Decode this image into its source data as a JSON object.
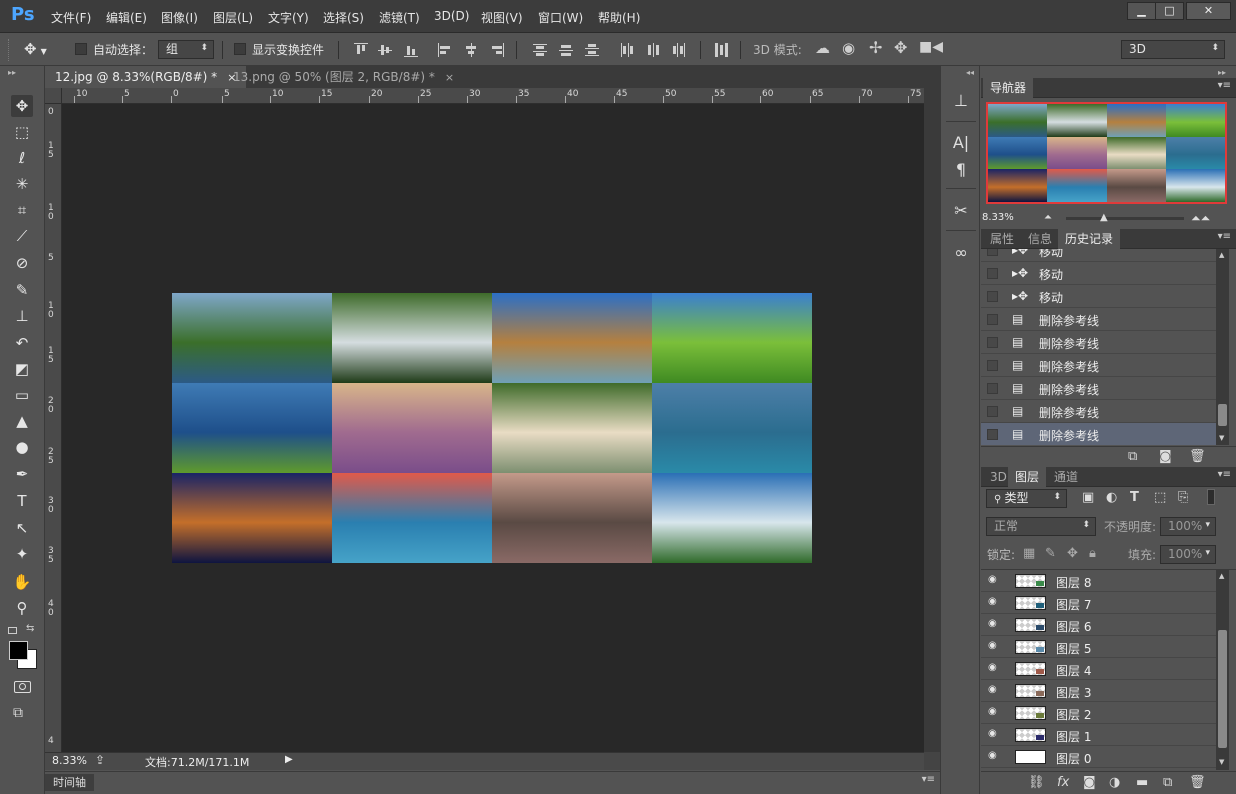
{
  "app": {
    "logo": "Ps"
  },
  "menu": [
    "文件(F)",
    "编辑(E)",
    "图像(I)",
    "图层(L)",
    "文字(Y)",
    "选择(S)",
    "滤镜(T)",
    "3D(D)",
    "视图(V)",
    "窗口(W)",
    "帮助(H)"
  ],
  "window_controls": {
    "minimize": "▁",
    "maximize": "□",
    "close": "✕"
  },
  "options": {
    "auto_select_label": "自动选择：",
    "auto_select_target": "组",
    "show_transform_label": "显示变换控件",
    "mode_3d_label": "3D 模式:",
    "workspace": "3D"
  },
  "tabs": [
    {
      "label": "12.jpg @ 8.33%(RGB/8#) *",
      "close": "×",
      "active": true
    },
    {
      "label": "13.png @ 50% (图层 2, RGB/8#) *",
      "close": "×",
      "active": false
    }
  ],
  "ruler_top": [
    "10",
    "5",
    "0",
    "5",
    "10",
    "15",
    "20",
    "25",
    "30",
    "35",
    "40",
    "45",
    "50",
    "55",
    "60",
    "65",
    "70",
    "75"
  ],
  "ruler_left": [
    "0",
    "1\n5",
    "1\n0",
    "5",
    "1\n0",
    "1\n5",
    "2\n0",
    "2\n5",
    "3\n0",
    "3\n5",
    "4\n0",
    "4"
  ],
  "tools": [
    {
      "icon": "move-icon",
      "glyph": "✥"
    },
    {
      "icon": "marquee-icon",
      "glyph": "⬚"
    },
    {
      "icon": "lasso-icon",
      "glyph": "ℓ"
    },
    {
      "icon": "magic-wand-icon",
      "glyph": "✳"
    },
    {
      "icon": "crop-icon",
      "glyph": "⌗"
    },
    {
      "icon": "eyedropper-icon",
      "glyph": "⟋"
    },
    {
      "icon": "healing-brush-icon",
      "glyph": "⊘"
    },
    {
      "icon": "brush-icon",
      "glyph": "✎"
    },
    {
      "icon": "clone-stamp-icon",
      "glyph": "⊥"
    },
    {
      "icon": "history-brush-icon",
      "glyph": "↶"
    },
    {
      "icon": "eraser-icon",
      "glyph": "◩"
    },
    {
      "icon": "gradient-icon",
      "glyph": "▭"
    },
    {
      "icon": "blur-icon",
      "glyph": "▲"
    },
    {
      "icon": "dodge-icon",
      "glyph": "●"
    },
    {
      "icon": "pen-icon",
      "glyph": "✒"
    },
    {
      "icon": "type-icon",
      "glyph": "T"
    },
    {
      "icon": "path-select-icon",
      "glyph": "↖"
    },
    {
      "icon": "shape-icon",
      "glyph": "✦"
    },
    {
      "icon": "hand-icon",
      "glyph": "✋"
    },
    {
      "icon": "zoom-icon",
      "glyph": "⚲"
    }
  ],
  "status": {
    "zoom": "8.33%",
    "doc": "文档:71.2M/171.1M"
  },
  "timeline_label": "时间轴",
  "navigator": {
    "tab": "导航器",
    "zoom": "8.33%"
  },
  "info_tabs": [
    "属性",
    "信息",
    "历史记录"
  ],
  "history": [
    {
      "label": "移动",
      "icon": "move-icon"
    },
    {
      "label": "移动",
      "icon": "move-icon"
    },
    {
      "label": "移动",
      "icon": "move-icon"
    },
    {
      "label": "删除参考线",
      "icon": "document-icon"
    },
    {
      "label": "删除参考线",
      "icon": "document-icon"
    },
    {
      "label": "删除参考线",
      "icon": "document-icon"
    },
    {
      "label": "删除参考线",
      "icon": "document-icon"
    },
    {
      "label": "删除参考线",
      "icon": "document-icon"
    },
    {
      "label": "删除参考线",
      "icon": "document-icon"
    }
  ],
  "layers_tabs": [
    "3D",
    "图层",
    "通道"
  ],
  "layers_panel": {
    "filter_kind": "类型",
    "blend_mode": "正常",
    "opacity_label": "不透明度:",
    "opacity": "100%",
    "lock_label": "锁定:",
    "fill_label": "填充:",
    "fill": "100%"
  },
  "layers": [
    "图层 8",
    "图层 7",
    "图层 6",
    "图层 5",
    "图层 4",
    "图层 3",
    "图层 2",
    "图层 1",
    "图层 0"
  ],
  "image_grid": {
    "cells": [
      {
        "name": "lake-mountains",
        "c1": "#7fa7c9",
        "c2": "#3b6f2a",
        "c3": "#2c5a86"
      },
      {
        "name": "waterfall-forest",
        "c1": "#3e6b2a",
        "c2": "#d5dde0",
        "c3": "#1f3b18"
      },
      {
        "name": "river-sunburst",
        "c1": "#2c6fc5",
        "c2": "#b5803f",
        "c3": "#6fa0b6"
      },
      {
        "name": "green-meadow",
        "c1": "#3a7fd0",
        "c2": "#7bbf3a",
        "c3": "#3f8a22"
      },
      {
        "name": "fjord-ship",
        "c1": "#3f7bb5",
        "c2": "#1e4f8a",
        "c3": "#5f9a2c"
      },
      {
        "name": "lavender-tree",
        "c1": "#d8b58a",
        "c2": "#a06b8f",
        "c3": "#7a4d8a"
      },
      {
        "name": "puppy-plants",
        "c1": "#3f6b2a",
        "c2": "#e9dcc4",
        "c3": "#7d8f70"
      },
      {
        "name": "lake-castle",
        "c1": "#4d7fa8",
        "c2": "#2b6d8f",
        "c3": "#2a8aa8"
      },
      {
        "name": "joshua-tree-night",
        "c1": "#1a2466",
        "c2": "#c46f2a",
        "c3": "#0e1440"
      },
      {
        "name": "sunset-pier",
        "c1": "#e05a4a",
        "c2": "#2a7fb0",
        "c3": "#46a3c8"
      },
      {
        "name": "misty-pond",
        "c1": "#c49a8a",
        "c2": "#5a4a44",
        "c3": "#8a6a66"
      },
      {
        "name": "rocky-coast",
        "c1": "#2a6fb5",
        "c2": "#d8e6ec",
        "c3": "#2f6a2a"
      }
    ]
  }
}
